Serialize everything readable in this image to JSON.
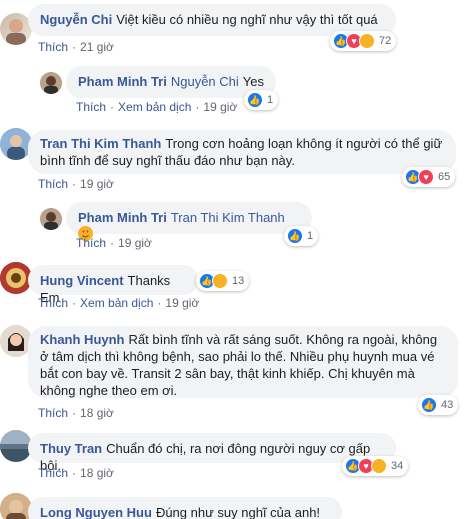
{
  "comments": [
    {
      "author": "Nguyễn Chi",
      "text": "Việt kiều có nhiều ng nghĩ như vậy thì tốt quá",
      "like_label": "Thích",
      "time": "21 giờ",
      "reaction_count": "72",
      "reactions": [
        "like-icon",
        "love-icon",
        "haha-icon"
      ]
    },
    {
      "author": "Pham Minh Tri",
      "mention": "Nguyễn Chi",
      "text": "Yes",
      "like_label": "Thích",
      "translate_label": "Xem bản dịch",
      "time": "19 giờ",
      "reaction_count": "1",
      "reactions": [
        "like-icon"
      ]
    },
    {
      "author": "Tran Thi Kim Thanh",
      "text": "Trong cơn hoảng loạn không ít người có thể giữ bình tĩnh để suy nghĩ thấu đáo như bạn này.",
      "like_label": "Thích",
      "time": "19 giờ",
      "reaction_count": "65",
      "reactions": [
        "like-icon",
        "love-icon"
      ]
    },
    {
      "author": "Pham Minh Tri",
      "mention": "Tran Thi Kim Thanh",
      "emoji": "heart-eyes-emoji",
      "like_label": "Thích",
      "time": "19 giờ",
      "reaction_count": "1",
      "reactions": [
        "like-icon"
      ]
    },
    {
      "author": "Hung Vincent",
      "text": "Thanks Em",
      "like_label": "Thích",
      "translate_label": "Xem bản dịch",
      "time": "19 giờ",
      "reaction_count": "13",
      "reactions": [
        "like-icon",
        "wow-icon"
      ]
    },
    {
      "author": "Khanh Huynh",
      "text": "Rất bình tĩnh và rất sáng suốt. Không ra ngoài, không ở tâm dịch thì không bệnh, sao phải lo thế. Nhiều phụ huynh mua vé bắt con bay về. Transit 2 sân bay, thật kinh khiếp. Chị khuyên mà không nghe theo em ơi.",
      "like_label": "Thích",
      "time": "18 giờ",
      "reaction_count": "43",
      "reactions": [
        "like-icon"
      ]
    },
    {
      "author": "Thuy Tran",
      "text": "Chuẩn đó chị, ra nơi đông người nguy cơ gấp bội.",
      "like_label": "Thích",
      "time": "18 giờ",
      "reaction_count": "34",
      "reactions": [
        "like-icon",
        "love-icon",
        "haha-icon"
      ]
    },
    {
      "author": "Long Nguyen Huu",
      "text": "Đúng như suy nghĩ của anh!"
    }
  ],
  "colors": {
    "author_link": "#385898",
    "bubble_bg": "#f2f3f5",
    "like_blue": "#1877f2",
    "love_red": "#f33e58",
    "haha_yellow": "#f7b125"
  }
}
